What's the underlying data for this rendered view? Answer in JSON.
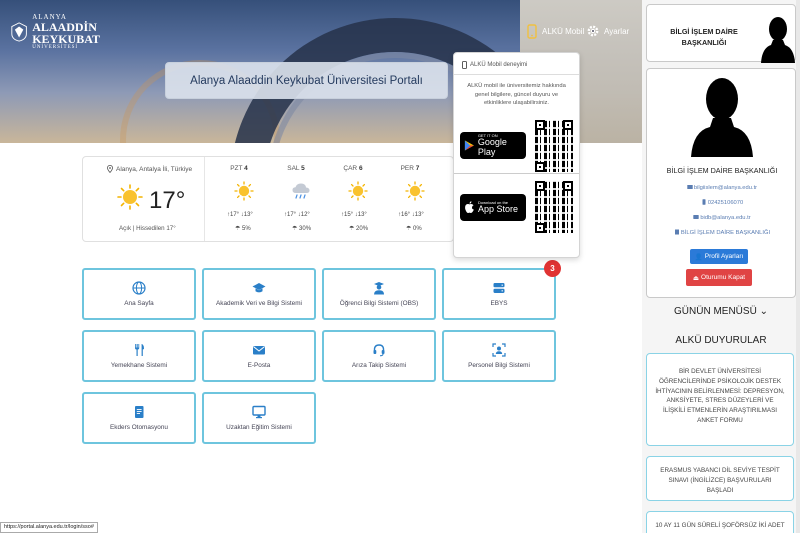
{
  "header": {
    "logo_lines": [
      "ALANYA",
      "ALAADDİN",
      "KEYKUBAT",
      "ÜNİVERSİTESİ"
    ],
    "mobile_label": "ALKÜ Mobil",
    "settings_label": "Ayarlar",
    "portal_title": "Alanya Alaaddin Keykubat Üniversitesi Portalı"
  },
  "app_popup": {
    "title": "ALKÜ Mobil deneyimi",
    "description": "ALKÜ mobil ile üniversitemiz hakkında genel bilgilere, güncel duyuru ve etkinliklere ulaşabilirsiniz.",
    "google_small": "GET IT ON",
    "google_big": "Google Play",
    "apple_small": "Download on the",
    "apple_big": "App Store"
  },
  "weather": {
    "location": "Alanya, Antalya İli, Türkiye",
    "temp": "17°",
    "condition": "Açık | Hissedilen 17°",
    "days": [
      {
        "abbr": "PZT",
        "num": "4",
        "icon": "sun-icon",
        "hl": "↑17° ↓13°",
        "rain": "5%"
      },
      {
        "abbr": "SAL",
        "num": "5",
        "icon": "rain-icon",
        "hl": "↑17° ↓12°",
        "rain": "30%"
      },
      {
        "abbr": "ÇAR",
        "num": "6",
        "icon": "sun-icon",
        "hl": "↑15° ↓13°",
        "rain": "20%"
      },
      {
        "abbr": "PER",
        "num": "7",
        "icon": "sun-icon",
        "hl": "↑16° ↓13°",
        "rain": "0%"
      }
    ]
  },
  "tiles": [
    {
      "label": "Ana Sayfa",
      "icon": "globe-icon"
    },
    {
      "label": "Akademik Veri ve Bilgi Sistemi",
      "icon": "graduation-cap-icon"
    },
    {
      "label": "Öğrenci Bilgi Sistemi (OBS)",
      "icon": "student-icon"
    },
    {
      "label": "EBYS",
      "icon": "server-icon"
    },
    {
      "label": "Yemekhane Sistemi",
      "icon": "cutlery-icon"
    },
    {
      "label": "E-Posta",
      "icon": "envelope-icon"
    },
    {
      "label": "Arıza Takip Sistemi",
      "icon": "headset-icon"
    },
    {
      "label": "Personel Bilgi Sistemi",
      "icon": "personnel-icon"
    },
    {
      "label": "Ekders Otomasyonu",
      "icon": "book-icon"
    },
    {
      "label": "Uzaktan Eğitim Sistemi",
      "icon": "monitor-icon"
    }
  ],
  "ebys_badge": "3",
  "sidebar": {
    "top_name": "BİLGİ İŞLEM DAİRE BAŞKANLIĞI",
    "profile_name": "BİLGİ İŞLEM DAİRE BAŞKANLIĞI",
    "email": "bilgiislem@alanya.edu.tr",
    "phone": "02425106070",
    "kep": "bidb@alanya.edu.tr",
    "unit": "BİLGİ İŞLEM DAİRE BAŞKANLIĞI",
    "profile_button": "Profil Ayarları",
    "logout_button": "Oturumu Kapat",
    "menu_heading": "GÜNÜN MENÜSÜ",
    "announcements_heading": "ALKÜ DUYURULAR",
    "announcements": [
      "BİR DEVLET ÜNİVERSİTESİ ÖĞRENCİLERİNDE PSİKOLOJİK DESTEK İHTİYACININ BELİRLENMESİ: DEPRESYON, ANKSİYETE, STRES DÜZEYLERİ VE İLİŞKİLİ ETMENLERİN ARAŞTIRILMASI ANKET FORMU",
      "ERASMUS YABANCI DİL SEVİYE TESPİT SINAVI (İNGİLİZCE) BAŞVURULARI BAŞLADI",
      "10 AY 11 GÜN SÜRELİ ŞOFÖRSÜZ İKİ ADET"
    ]
  },
  "status_url": "https://portal.alanya.edu.tr/login/sso#"
}
